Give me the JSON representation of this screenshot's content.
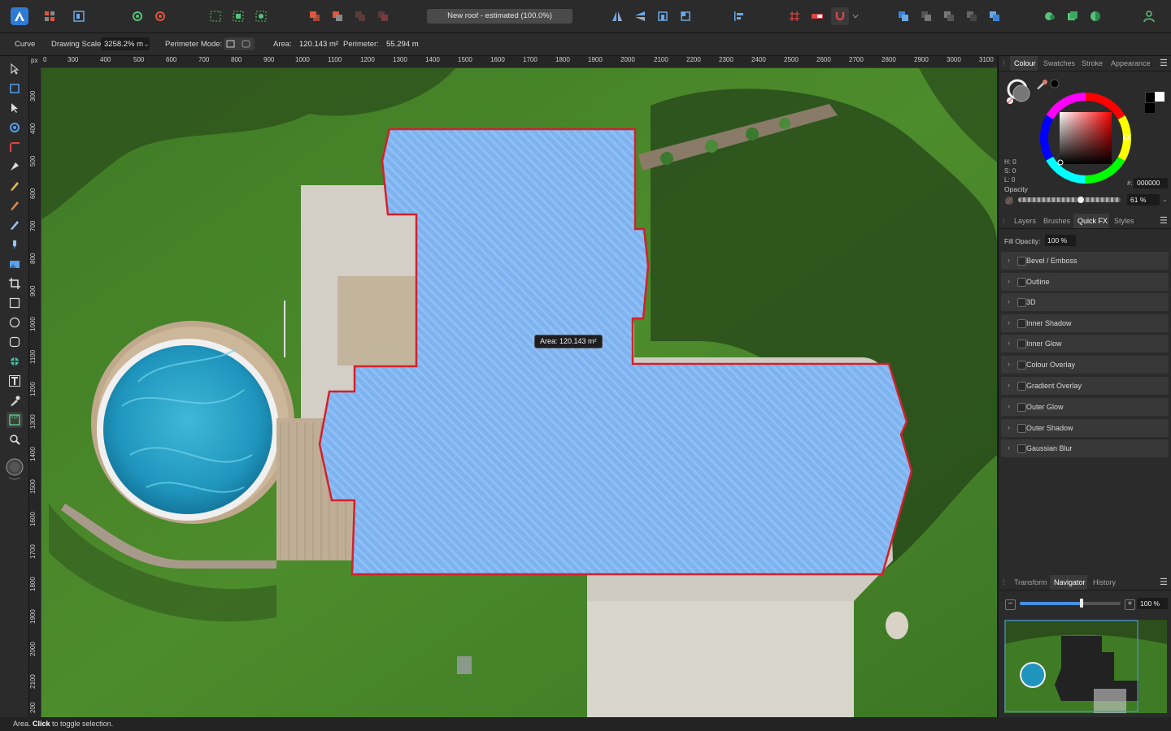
{
  "app": {
    "document_title": "New roof - estimated (100.0%)"
  },
  "context_bar": {
    "tool_name": "Curve",
    "drawing_scale_label": "Drawing Scale:",
    "drawing_scale_value": "3258.2% m",
    "perimeter_mode_label": "Perimeter Mode:",
    "area_label": "Area:",
    "area_value": "120.143 m²",
    "perimeter_label": "Perimeter:",
    "perimeter_value": "55.294 m"
  },
  "rulers": {
    "unit": "px",
    "horizontal_ticks": [
      "0",
      "300",
      "400",
      "500",
      "600",
      "700",
      "800",
      "900",
      "1000",
      "1100",
      "1200",
      "1300",
      "1400",
      "1500",
      "1600",
      "1700",
      "1800",
      "1900",
      "2000",
      "2100",
      "2200",
      "2300",
      "2400",
      "2500",
      "2600",
      "2700",
      "2800",
      "2900",
      "3000",
      "3100"
    ],
    "vertical_ticks": [
      "300",
      "400",
      "500",
      "600",
      "700",
      "800",
      "900",
      "1000",
      "1100",
      "1200",
      "1300",
      "1400",
      "1500",
      "1600",
      "1700",
      "1800",
      "1900",
      "2000",
      "2100",
      "200"
    ]
  },
  "canvas": {
    "area_tooltip": "Area: 120.143 m²",
    "measure_fill": "#7fb3f0",
    "measure_stroke": "#d4202a"
  },
  "colour_panel": {
    "tabs": [
      "Colour",
      "Swatches",
      "Stroke",
      "Appearance"
    ],
    "active_tab": "Colour",
    "h_label": "H: 0",
    "s_label": "S: 0",
    "l_label": "L: 0",
    "hex_label": "#:",
    "hex_value": "000000",
    "opacity_label": "Opacity",
    "opacity_value": "61 %"
  },
  "fx_panel": {
    "tabs": [
      "Layers",
      "Brushes",
      "Quick FX",
      "Styles"
    ],
    "active_tab": "Quick FX",
    "fill_opacity_label": "Fill Opacity:",
    "fill_opacity_value": "100 %",
    "effects": [
      "Bevel / Emboss",
      "Outline",
      "3D",
      "Inner Shadow",
      "Inner Glow",
      "Colour Overlay",
      "Gradient Overlay",
      "Outer Glow",
      "Outer Shadow",
      "Gaussian Blur"
    ]
  },
  "navigator_panel": {
    "tabs": [
      "Transform",
      "Navigator",
      "History"
    ],
    "active_tab": "Navigator",
    "zoom_value": "100 %"
  },
  "status_bar": {
    "prefix": "Area. ",
    "click": "Click",
    "suffix": " to toggle selection."
  }
}
